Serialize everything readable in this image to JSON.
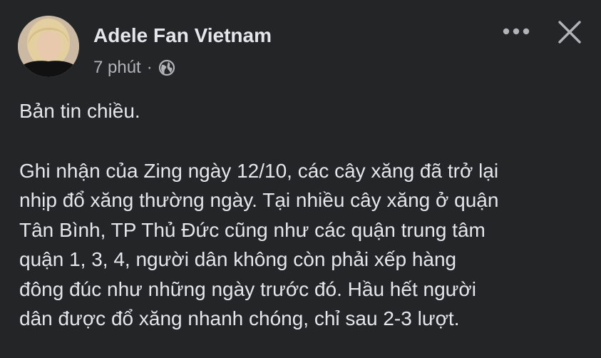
{
  "post": {
    "author": "Adele Fan Vietnam",
    "timestamp": "7 phút",
    "separator": "·",
    "audience_icon": "globe-icon",
    "more_icon": "more-horizontal-icon",
    "close_icon": "close-icon",
    "greeting": "Bản tin chiều.",
    "body_lines": [
      "Ghi nhận của Zing ngày 12/10, các cây xăng đã trở lại",
      "nhịp đổ xăng thường ngày. Tại nhiều cây xăng ở quận",
      "Tân Bình, TP Thủ Đức cũng như các quận trung tâm",
      "quận 1, 3, 4, người dân không còn phải xếp hàng",
      "đông đúc như những ngày trước đó. Hầu hết người",
      "dân được đổ xăng nhanh chóng, chỉ sau 2-3 lượt."
    ]
  },
  "colors": {
    "background": "#242526",
    "primary_text": "#e4e6eb",
    "secondary_text": "#b0b3b8"
  }
}
